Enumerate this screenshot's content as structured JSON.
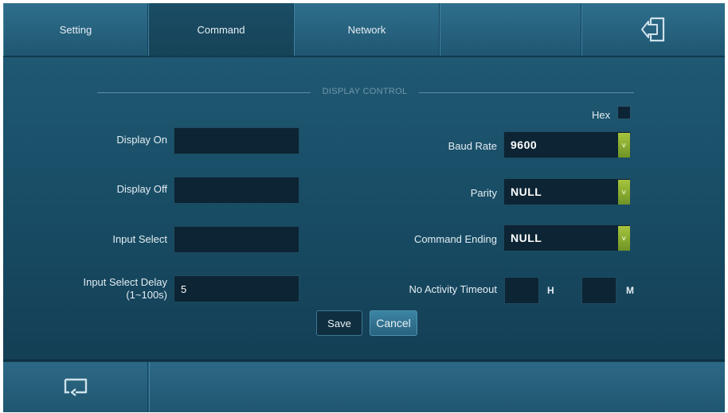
{
  "tabs": [
    {
      "label": "Setting"
    },
    {
      "label": "Command"
    },
    {
      "label": "Network"
    },
    {
      "label": ""
    }
  ],
  "icons": {
    "exit": "exit-door-icon",
    "back": "return-icon",
    "dropdown": "chevron-down-icon"
  },
  "section": {
    "title": "DISPLAY CONTROL"
  },
  "hex": {
    "label": "Hex",
    "checked": false
  },
  "left_fields": {
    "display_on": {
      "label": "Display On",
      "value": ""
    },
    "display_off": {
      "label": "Display Off",
      "value": ""
    },
    "input_select": {
      "label": "Input Select",
      "value": ""
    },
    "input_select_delay": {
      "label_line1": "Input Select Delay",
      "label_line2": "(1~100s)",
      "value": "5"
    }
  },
  "right_fields": {
    "baud_rate": {
      "label": "Baud Rate",
      "value": "9600"
    },
    "parity": {
      "label": "Parity",
      "value": "NULL"
    },
    "command_ending": {
      "label": "Command Ending",
      "value": "NULL"
    },
    "no_activity_timeout": {
      "label": "No Activity Timeout",
      "hours": "",
      "minutes": "",
      "hours_unit": "H",
      "minutes_unit": "M"
    }
  },
  "buttons": {
    "save": "Save",
    "cancel": "Cancel"
  },
  "colors": {
    "background": "#0c2636",
    "panel": "#1a4e67",
    "accent_green": "#8fb234",
    "field": "#0c2433"
  }
}
